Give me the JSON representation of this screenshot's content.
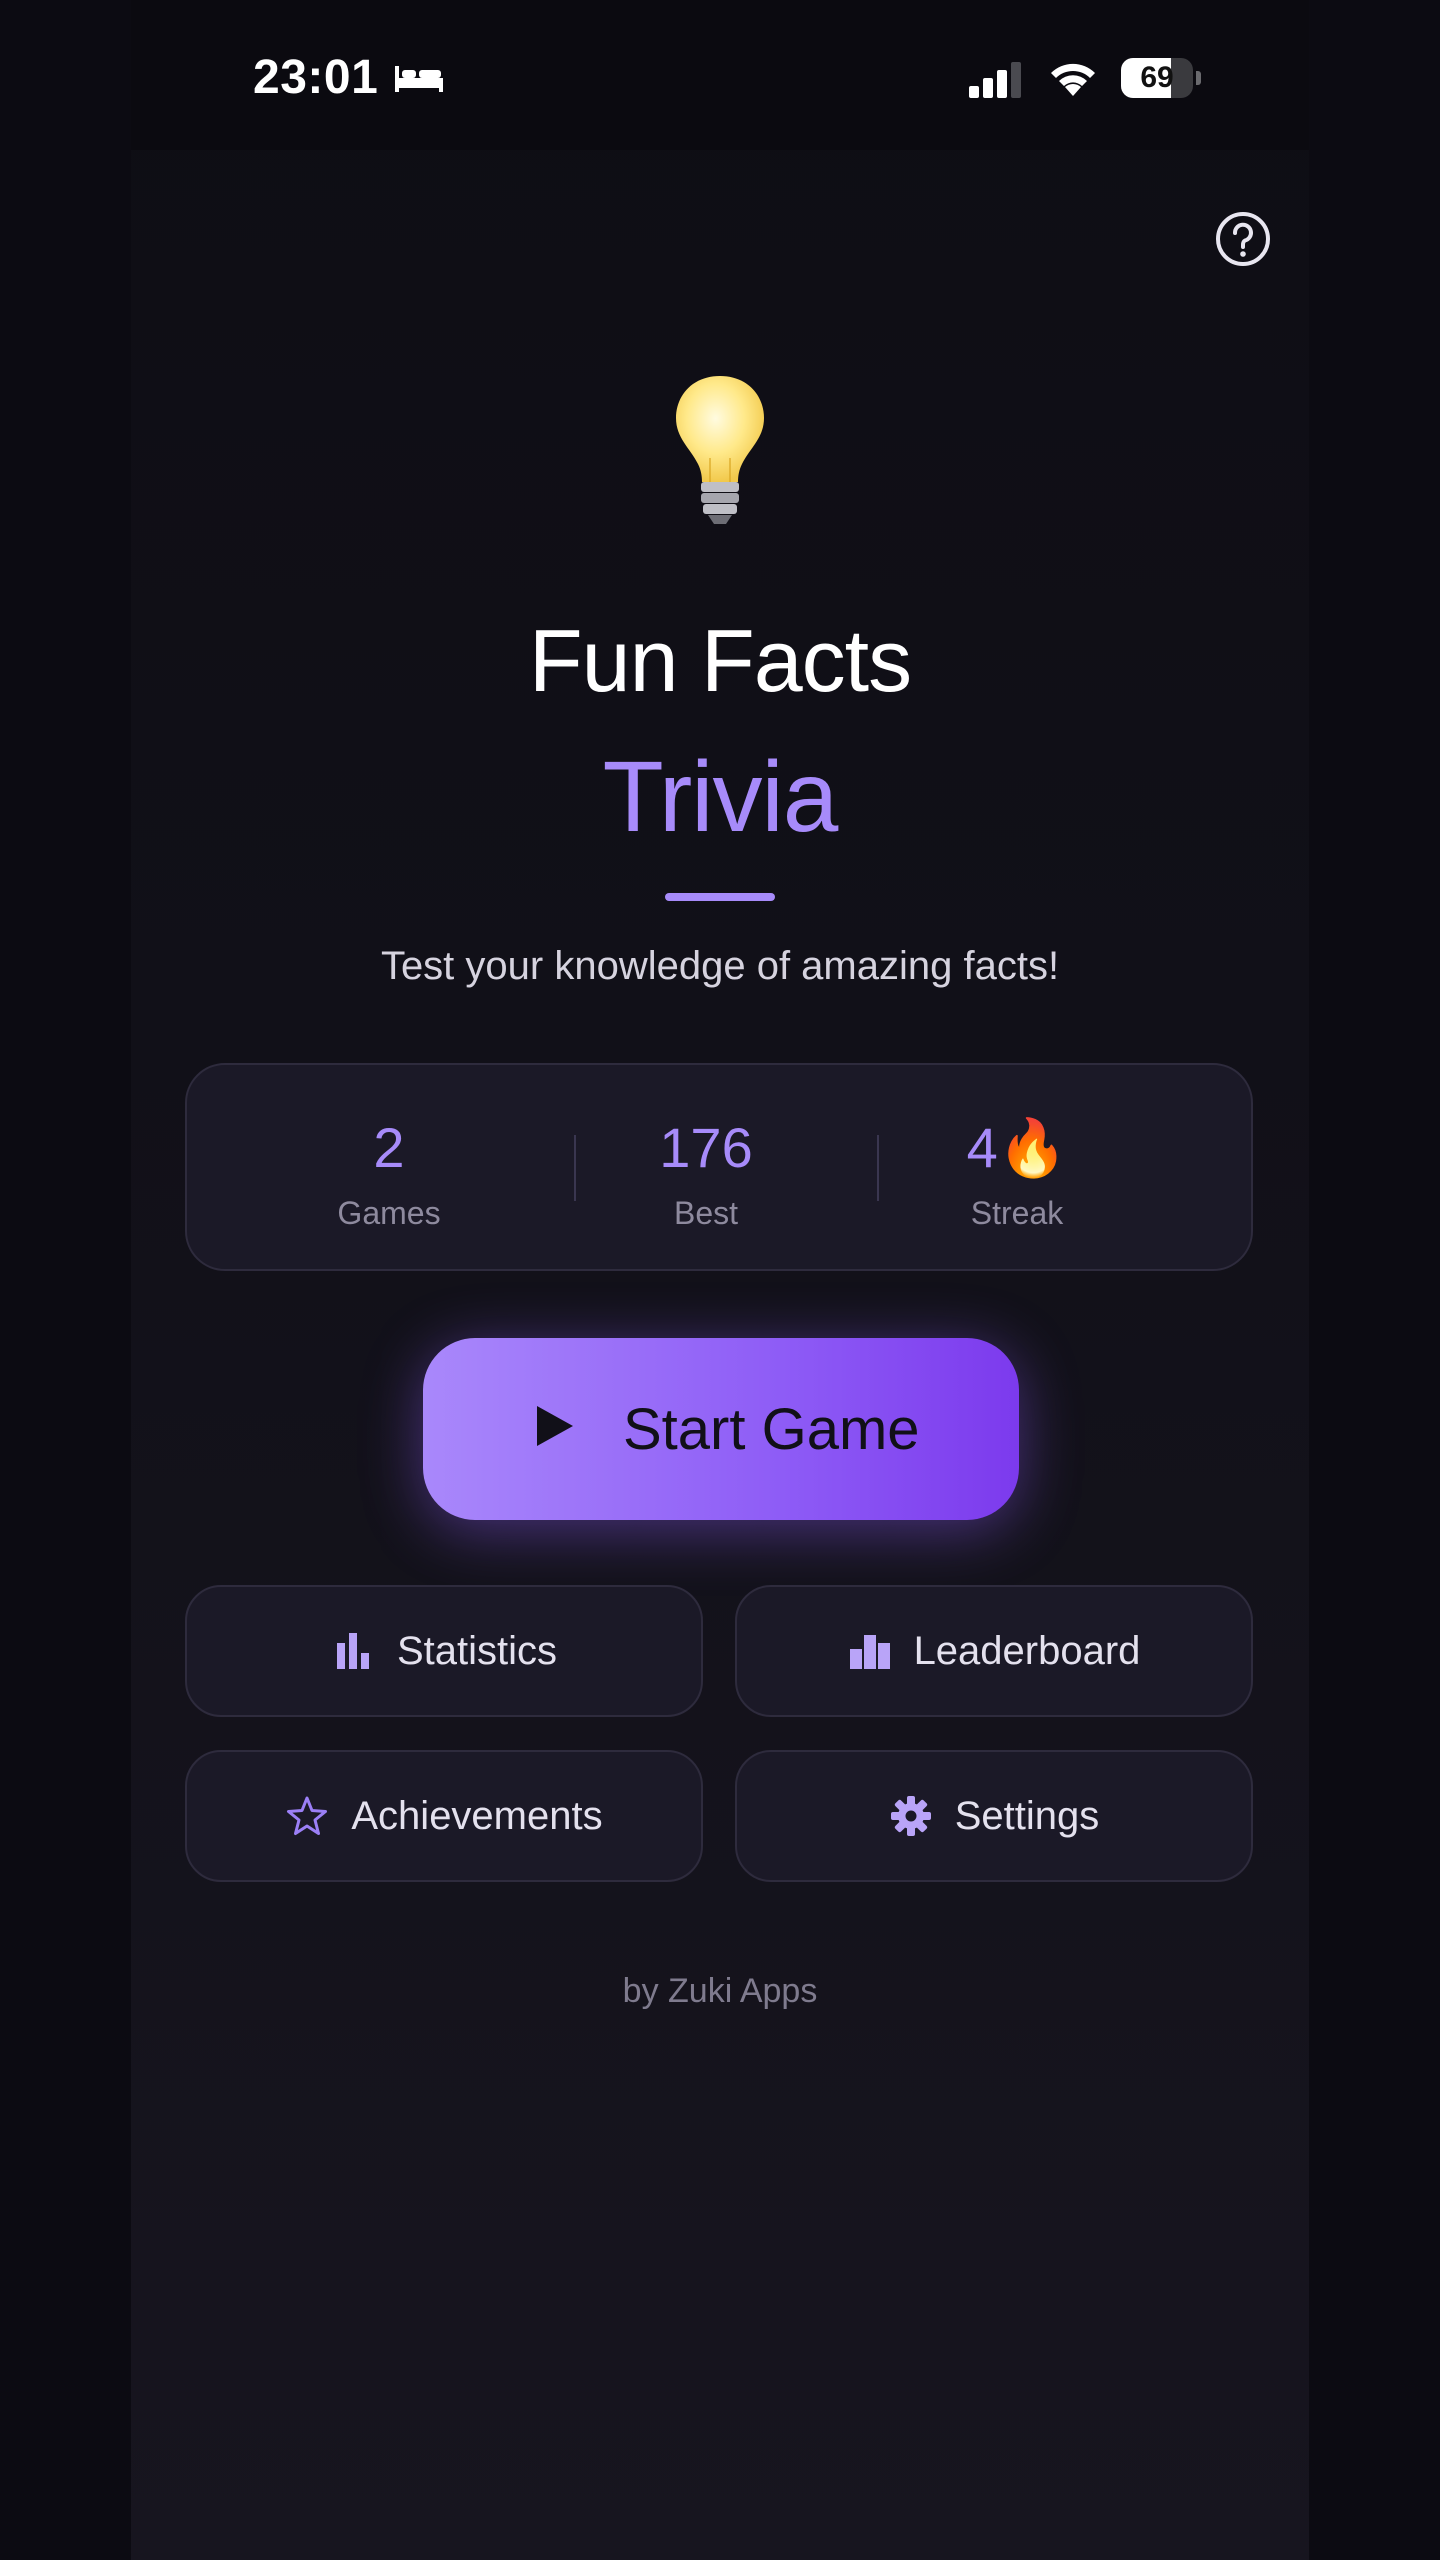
{
  "status_bar": {
    "time": "23:01",
    "battery_level": "69",
    "battery_fraction": 0.69,
    "icons": [
      "bed-icon",
      "cellular-signal-icon",
      "wifi-icon",
      "battery-icon"
    ]
  },
  "header": {
    "help_icon": "question-circle-icon"
  },
  "hero": {
    "icon": "light-bulb-icon",
    "title_line1": "Fun Facts",
    "title_line2": "Trivia",
    "subtitle": "Test your knowledge of amazing facts!"
  },
  "stats": [
    {
      "value": "2",
      "label": "Games"
    },
    {
      "value": "176",
      "label": "Best"
    },
    {
      "value": "4🔥",
      "label": "Streak"
    }
  ],
  "start_button": {
    "icon": "play-icon",
    "label": "Start Game"
  },
  "menu": {
    "statistics": {
      "label": "Statistics",
      "icon": "bar-chart-icon"
    },
    "leaderboard": {
      "label": "Leaderboard",
      "icon": "leaderboard-icon"
    },
    "achievements": {
      "label": "Achievements",
      "icon": "star-icon"
    },
    "settings": {
      "label": "Settings",
      "icon": "gear-icon"
    }
  },
  "footer": {
    "credit": "by Zuki Apps"
  },
  "colors": {
    "accent": "#a78bfa",
    "button_gradient_start": "#a988fb",
    "button_gradient_end": "#7c3aed",
    "background": "#111018",
    "card": "#1b1927"
  }
}
